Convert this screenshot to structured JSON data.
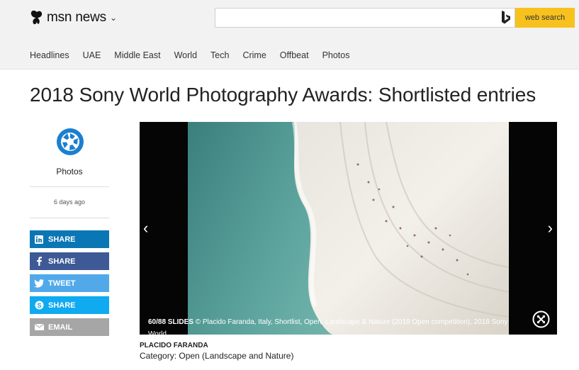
{
  "header": {
    "brand": "msn news",
    "search_button": "web search",
    "search_placeholder": ""
  },
  "nav": [
    "Headlines",
    "UAE",
    "Middle East",
    "World",
    "Tech",
    "Crime",
    "Offbeat",
    "Photos"
  ],
  "article": {
    "title": "2018 Sony World Photography Awards: Shortlisted entries",
    "source": "Photos",
    "age": "6 days ago"
  },
  "share": [
    {
      "label": "SHARE",
      "icon": "linkedin-icon",
      "color": "#0a76b4"
    },
    {
      "label": "SHARE",
      "icon": "facebook-icon",
      "color": "#3d5a96"
    },
    {
      "label": "TWEET",
      "icon": "twitter-icon",
      "color": "#52a9ea"
    },
    {
      "label": "SHARE",
      "icon": "skype-icon",
      "color": "#10aaf0"
    },
    {
      "label": "EMAIL",
      "icon": "email-icon",
      "color": "#a6a6a6"
    }
  ],
  "slideshow": {
    "counter": "60/88 SLIDES",
    "caption": "© Placido Faranda, Italy, Shortlist, Open, Landscape & Nature (2018 Open competition), 2018 Sony World...",
    "credit": "PLACIDO FARANDA",
    "category": "Category: Open (Landscape and Nature)"
  },
  "colors": {
    "search_button": "#f7c11e",
    "header_bg": "#f2f2f2"
  }
}
